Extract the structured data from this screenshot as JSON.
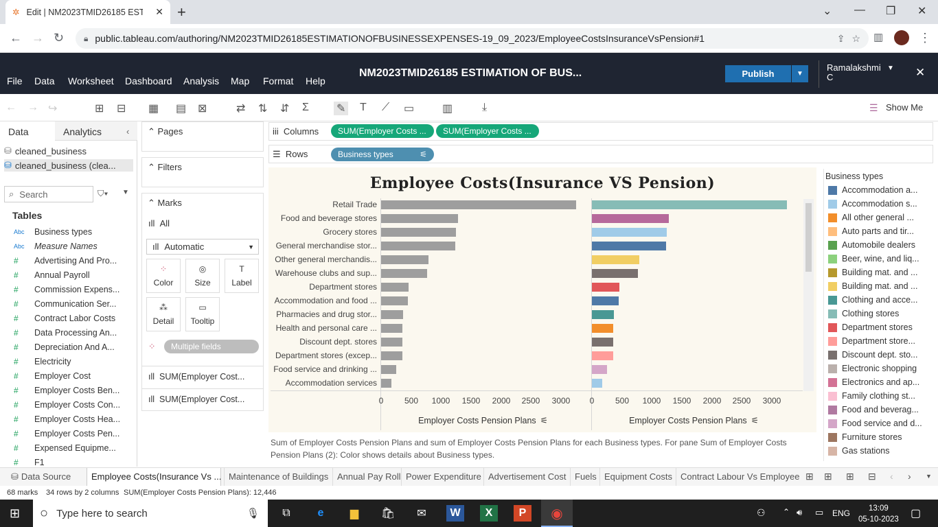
{
  "browser": {
    "tab_title": "Edit | NM2023TMID26185 ESTIM",
    "url": "public.tableau.com/authoring/NM2023TMID26185ESTIMATIONOFBUSINESSEXPENSES-19_09_2023/EmployeeCostsInsuranceVsPension#1"
  },
  "app": {
    "menus": [
      "File",
      "Data",
      "Worksheet",
      "Dashboard",
      "Analysis",
      "Map",
      "Format",
      "Help"
    ],
    "workbook_title": "NM2023TMID26185 ESTIMATION OF BUS...",
    "publish_label": "Publish",
    "user_name_line1": "Ramalakshmi",
    "user_name_line2": "C",
    "show_me": "Show Me"
  },
  "left_pane": {
    "tab_data": "Data",
    "tab_analytics": "Analytics",
    "sources": [
      "cleaned_business",
      "cleaned_business (clea..."
    ],
    "search_placeholder": "Search",
    "tables_heading": "Tables",
    "fields": [
      {
        "type": "Abc",
        "name": "Business types"
      },
      {
        "type": "Abc",
        "name": "Measure Names"
      },
      {
        "type": "#",
        "name": "Advertising And Pro..."
      },
      {
        "type": "#",
        "name": "Annual Payroll"
      },
      {
        "type": "#",
        "name": "Commission Expens..."
      },
      {
        "type": "#",
        "name": "Communication Ser..."
      },
      {
        "type": "#",
        "name": "Contract Labor Costs"
      },
      {
        "type": "#",
        "name": "Data Processing An..."
      },
      {
        "type": "#",
        "name": "Depreciation And A..."
      },
      {
        "type": "#",
        "name": "Electricity"
      },
      {
        "type": "#",
        "name": "Employer Cost"
      },
      {
        "type": "#",
        "name": "Employer Costs Ben..."
      },
      {
        "type": "#",
        "name": "Employer Costs Con..."
      },
      {
        "type": "#",
        "name": "Employer Costs Hea..."
      },
      {
        "type": "#",
        "name": "Employer Costs Pen..."
      },
      {
        "type": "#",
        "name": "Expensed Equipme..."
      },
      {
        "type": "#",
        "name": "F1"
      }
    ]
  },
  "cards": {
    "pages": "Pages",
    "filters": "Filters",
    "marks": "Marks",
    "all": "All",
    "mark_type": "Automatic",
    "mark_buttons": [
      "Color",
      "Size",
      "Label",
      "Detail",
      "Tooltip"
    ],
    "multiple_fields": "Multiple fields",
    "measure1": "SUM(Employer Cost...",
    "measure2": "SUM(Employer Cost..."
  },
  "shelves": {
    "columns_label": "Columns",
    "rows_label": "Rows",
    "col_pill1": "SUM(Employer Costs ...",
    "col_pill2": "SUM(Employer Costs ...",
    "row_pill": "Business types"
  },
  "chart_data": {
    "type": "bar",
    "title": "Employee Costs(Insurance VS Pension)",
    "categories": [
      "Retail Trade",
      "Food and beverage stores",
      "Grocery stores",
      "General merchandise stor...",
      "Other general merchandis...",
      "Warehouse clubs and sup...",
      "Department stores",
      "Accommodation and food ...",
      "Pharmacies and drug stor...",
      "Health and personal care ...",
      "Discount dept. stores",
      "Department stores (excep...",
      "Food service and drinking ...",
      "Accommodation services"
    ],
    "series": [
      {
        "values": [
          3250,
          1280,
          1250,
          1240,
          790,
          770,
          460,
          450,
          370,
          360,
          360,
          360,
          250,
          170
        ],
        "colors": [
          "#9e9e9e",
          "#9e9e9e",
          "#9e9e9e",
          "#9e9e9e",
          "#9e9e9e",
          "#9e9e9e",
          "#9e9e9e",
          "#9e9e9e",
          "#9e9e9e",
          "#9e9e9e",
          "#9e9e9e",
          "#9e9e9e",
          "#9e9e9e",
          "#9e9e9e"
        ]
      },
      {
        "values": [
          3250,
          1280,
          1250,
          1240,
          790,
          770,
          460,
          450,
          370,
          360,
          360,
          360,
          250,
          170
        ],
        "colors": [
          "#86bcb6",
          "#b6699b",
          "#a0cbe8",
          "#4e79a7",
          "#f1ce63",
          "#79706e",
          "#e15759",
          "#4e79a7",
          "#499894",
          "#f28e2b",
          "#79706e",
          "#ff9d9a",
          "#d4a6c8",
          "#a0cbe8"
        ]
      }
    ],
    "xlabel": "Employer Costs Pension Plans",
    "x_ticks": [
      0,
      500,
      1000,
      1500,
      2000,
      2500,
      3000
    ],
    "xlim": [
      0,
      3400
    ],
    "caption": "Sum of Employer Costs Pension Plans and sum of Employer Costs Pension Plans for each Business types.  For pane Sum of Employer Costs Pension Plans (2):  Color shows details about Business types."
  },
  "legend": {
    "title": "Business types",
    "items": [
      {
        "label": "Accommodation a...",
        "color": "#4e79a7"
      },
      {
        "label": "Accommodation s...",
        "color": "#a0cbe8"
      },
      {
        "label": "All other general ...",
        "color": "#f28e2b"
      },
      {
        "label": "Auto parts and tir...",
        "color": "#ffbe7d"
      },
      {
        "label": "Automobile dealers",
        "color": "#59a14f"
      },
      {
        "label": "Beer, wine, and liq...",
        "color": "#8cd17d"
      },
      {
        "label": "Building mat. and ...",
        "color": "#b6992d"
      },
      {
        "label": "Building mat. and ...",
        "color": "#f1ce63"
      },
      {
        "label": "Clothing and acce...",
        "color": "#499894"
      },
      {
        "label": "Clothing stores",
        "color": "#86bcb6"
      },
      {
        "label": "Department stores",
        "color": "#e15759"
      },
      {
        "label": "Department store...",
        "color": "#ff9d9a"
      },
      {
        "label": "Discount dept. sto...",
        "color": "#79706e"
      },
      {
        "label": "Electronic shopping",
        "color": "#bab0ac"
      },
      {
        "label": "Electronics and ap...",
        "color": "#d37295"
      },
      {
        "label": "Family clothing st...",
        "color": "#fabfd2"
      },
      {
        "label": "Food and beverag...",
        "color": "#b07aa1"
      },
      {
        "label": "Food service and d...",
        "color": "#d4a6c8"
      },
      {
        "label": "Furniture stores",
        "color": "#9d7660"
      },
      {
        "label": "Gas stations",
        "color": "#d7b5a6"
      }
    ]
  },
  "sheets": [
    "Data Source",
    "Employee Costs(Insurance Vs ...",
    "Maintenance of Buildings",
    "Annual Pay Roll",
    "Power Expenditure",
    "Advertisement Cost",
    "Fuels",
    "Equipment Costs",
    "Contract Labour Vs Employee"
  ],
  "status": {
    "marks": "68 marks",
    "rows_cols": "34 rows by 2 columns",
    "sum": "SUM(Employer Costs Pension Plans): 12,446"
  },
  "taskbar": {
    "search_placeholder": "Type here to search",
    "lang": "ENG",
    "time": "13:09",
    "date": "05-10-2023"
  }
}
